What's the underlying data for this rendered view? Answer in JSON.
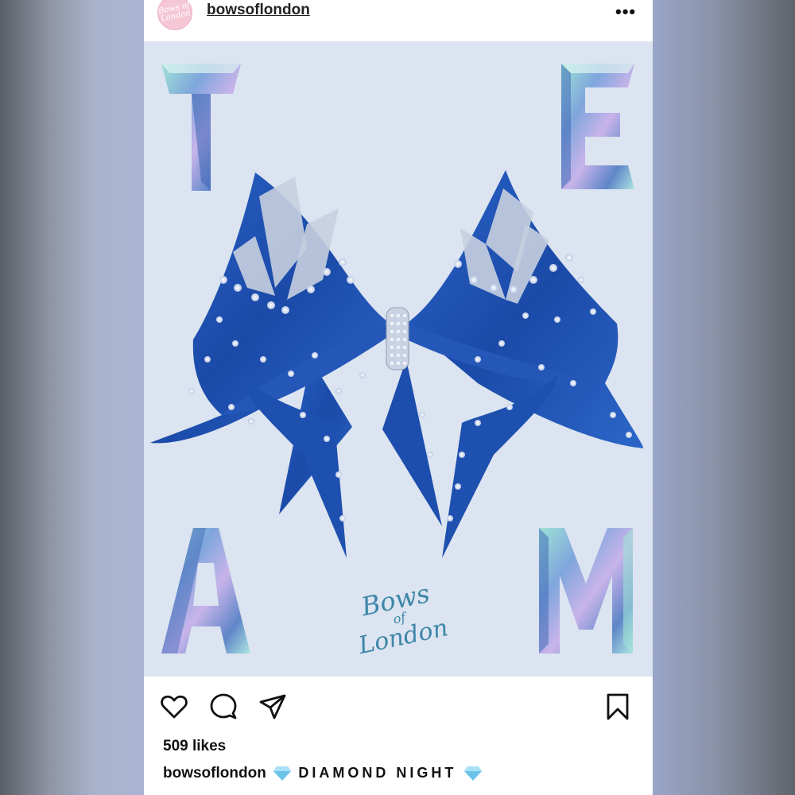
{
  "post": {
    "username": "bowsoflondon",
    "avatar_text": "Bows of London",
    "more_label": "•••",
    "image": {
      "letters": [
        "T",
        "E",
        "A",
        "M"
      ],
      "logo": {
        "line1": "Bows",
        "line2": "of",
        "line3": "London"
      },
      "bow_color": "#1f52b4",
      "background_color": "#dbe4f0"
    },
    "actions": {
      "like_icon": "heart-icon",
      "comment_icon": "comment-icon",
      "share_icon": "send-icon",
      "save_icon": "bookmark-icon"
    },
    "likes": "509 likes",
    "caption": {
      "user": "bowsoflondon",
      "gem_left": "💎",
      "text": "DIAMOND NIGHT",
      "gem_right": "💎"
    }
  }
}
